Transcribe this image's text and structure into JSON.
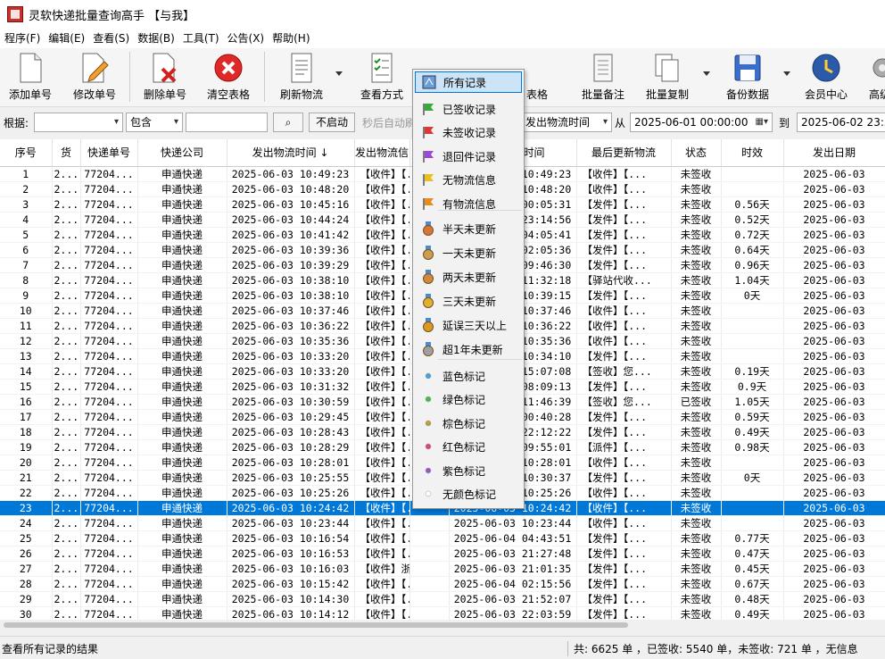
{
  "window": {
    "title": "灵软快递批量查询高手 【与我】"
  },
  "menu": [
    "程序(F)",
    "编辑(E)",
    "查看(S)",
    "数据(B)",
    "工具(T)",
    "公告(X)",
    "帮助(H)"
  ],
  "toolbar": {
    "add": "添加单号",
    "edit": "修改单号",
    "delete": "删除单号",
    "clear": "清空表格",
    "refresh": "刷新物流",
    "view_mode": "查看方式",
    "export": "表格",
    "batch_note": "批量备注",
    "batch_copy": "批量复制",
    "backup": "备份数据",
    "member": "会员中心",
    "advanced": "高级"
  },
  "filter": {
    "by_label": "根据:",
    "field_value": "",
    "match_value": "包含",
    "keyword_value": "",
    "not_started": "不启动",
    "auto_refresh_hint": "秒后自动刷",
    "time_field": "发出物流时间",
    "from_label": "从",
    "from_value": "2025-06-01 00:00:00",
    "to_label": "到",
    "to_value": "2025-06-02 23:5"
  },
  "columns": [
    "序号",
    "货",
    "快递单号",
    "快递公司",
    "发出物流时间 ↓",
    "发出物流信",
    "",
    "最后更新时间",
    "最后更新物流",
    "状态",
    "时效",
    "发出日期"
  ],
  "rows": [
    [
      "1",
      "2...",
      "77204...",
      "申通快递",
      "2025-06-03 10:49:23",
      "【收件】【...",
      "",
      "2025-06-03 10:49:23",
      "【收件】【...",
      "未签收",
      "",
      "2025-06-03"
    ],
    [
      "2",
      "2...",
      "77204...",
      "申通快递",
      "2025-06-03 10:48:20",
      "【收件】【...",
      "",
      "2025-06-03 10:48:20",
      "【收件】【...",
      "未签收",
      "",
      "2025-06-03"
    ],
    [
      "3",
      "2...",
      "77204...",
      "申通快递",
      "2025-06-03 10:45:16",
      "【收件】【...",
      "",
      "2025-06-04 00:05:31",
      "【发件】【...",
      "未签收",
      "0.56天",
      "2025-06-03"
    ],
    [
      "4",
      "2...",
      "77204...",
      "申通快递",
      "2025-06-03 10:44:24",
      "【收件】【...",
      "",
      "2025-06-03 23:14:56",
      "【发件】【...",
      "未签收",
      "0.52天",
      "2025-06-03"
    ],
    [
      "5",
      "2...",
      "77204...",
      "申通快递",
      "2025-06-03 10:41:42",
      "【收件】【...",
      "",
      "2025-06-04 04:05:41",
      "【发件】【...",
      "未签收",
      "0.72天",
      "2025-06-03"
    ],
    [
      "6",
      "2...",
      "77204...",
      "申通快递",
      "2025-06-03 10:39:36",
      "【收件】【...",
      "",
      "2025-06-04 02:05:36",
      "【发件】【...",
      "未签收",
      "0.64天",
      "2025-06-03"
    ],
    [
      "7",
      "2...",
      "77204...",
      "申通快递",
      "2025-06-03 10:39:29",
      "【收件】【...",
      "",
      "2025-06-04 09:46:30",
      "【发件】【...",
      "未签收",
      "0.96天",
      "2025-06-03"
    ],
    [
      "8",
      "2...",
      "77204...",
      "申通快递",
      "2025-06-03 10:38:10",
      "【收件】【...",
      "",
      "2025-06-04 11:32:18",
      "【驿站代收...",
      "未签收",
      "1.04天",
      "2025-06-03"
    ],
    [
      "9",
      "2...",
      "77204...",
      "申通快递",
      "2025-06-03 10:38:10",
      "【收件】【...",
      "",
      "2025-06-03 10:39:15",
      "【发件】【...",
      "未签收",
      "0天",
      "2025-06-03"
    ],
    [
      "10",
      "2...",
      "77204...",
      "申通快递",
      "2025-06-03 10:37:46",
      "【收件】【...",
      "",
      "2025-06-03 10:37:46",
      "【收件】【...",
      "未签收",
      "",
      "2025-06-03"
    ],
    [
      "11",
      "2...",
      "77204...",
      "申通快递",
      "2025-06-03 10:36:22",
      "【收件】【...",
      "",
      "2025-06-03 10:36:22",
      "【收件】【...",
      "未签收",
      "",
      "2025-06-03"
    ],
    [
      "12",
      "2...",
      "77204...",
      "申通快递",
      "2025-06-03 10:35:36",
      "【收件】【...",
      "",
      "2025-06-03 10:35:36",
      "【收件】【...",
      "未签收",
      "",
      "2025-06-03"
    ],
    [
      "13",
      "2...",
      "77204...",
      "申通快递",
      "2025-06-03 10:33:20",
      "【收件】【...",
      "",
      "2025-06-03 10:34:10",
      "【发件】【...",
      "未签收",
      "",
      "2025-06-03"
    ],
    [
      "14",
      "2...",
      "77204...",
      "申通快递",
      "2025-06-03 10:33:20",
      "【收件】【...",
      "",
      "2025-06-03 15:07:08",
      "【签收】您...",
      "未签收",
      "0.19天",
      "2025-06-03"
    ],
    [
      "15",
      "2...",
      "77204...",
      "申通快递",
      "2025-06-03 10:31:32",
      "【收件】【...",
      "",
      "2025-06-03 08:09:13",
      "【发件】【...",
      "未签收",
      "0.9天",
      "2025-06-03"
    ],
    [
      "16",
      "2...",
      "77204...",
      "申通快递",
      "2025-06-03 10:30:59",
      "【收件】【...",
      "",
      "2025-06-04 11:46:39",
      "【签收】您...",
      "已签收",
      "1.05天",
      "2025-06-03"
    ],
    [
      "17",
      "2...",
      "77204...",
      "申通快递",
      "2025-06-03 10:29:45",
      "【收件】【...",
      "",
      "2025-06-04 00:40:28",
      "【发件】【...",
      "未签收",
      "0.59天",
      "2025-06-03"
    ],
    [
      "18",
      "2...",
      "77204...",
      "申通快递",
      "2025-06-03 10:28:43",
      "【收件】【...",
      "",
      "2025-06-03 22:12:22",
      "【发件】【...",
      "未签收",
      "0.49天",
      "2025-06-03"
    ],
    [
      "19",
      "2...",
      "77204...",
      "申通快递",
      "2025-06-03 10:28:29",
      "【收件】【...",
      "",
      "2025-06-04 09:55:01",
      "【派件】【...",
      "未签收",
      "0.98天",
      "2025-06-03"
    ],
    [
      "20",
      "2...",
      "77204...",
      "申通快递",
      "2025-06-03 10:28:01",
      "【收件】【...",
      "",
      "2025-06-03 10:28:01",
      "【收件】【...",
      "未签收",
      "",
      "2025-06-03"
    ],
    [
      "21",
      "2...",
      "77204...",
      "申通快递",
      "2025-06-03 10:25:55",
      "【收件】【...",
      "",
      "2025-06-03 10:30:37",
      "【发件】【...",
      "未签收",
      "0天",
      "2025-06-03"
    ],
    [
      "22",
      "2...",
      "77204...",
      "申通快递",
      "2025-06-03 10:25:26",
      "【收件】【...",
      "",
      "2025-06-03 10:25:26",
      "【收件】【...",
      "未签收",
      "",
      "2025-06-03"
    ],
    [
      "23",
      "2...",
      "77204...",
      "申通快递",
      "2025-06-03 10:24:42",
      "【收件】【...",
      "",
      "2025-06-03 10:24:42",
      "【收件】【...",
      "未签收",
      "",
      "2025-06-03"
    ],
    [
      "24",
      "2...",
      "77204...",
      "申通快递",
      "2025-06-03 10:23:44",
      "【收件】【...",
      "",
      "2025-06-03 10:23:44",
      "【收件】【...",
      "未签收",
      "",
      "2025-06-03"
    ],
    [
      "25",
      "2...",
      "77204...",
      "申通快递",
      "2025-06-03 10:16:54",
      "【收件】【...",
      "",
      "2025-06-04 04:43:51",
      "【发件】【...",
      "未签收",
      "0.77天",
      "2025-06-03"
    ],
    [
      "26",
      "2...",
      "77204...",
      "申通快递",
      "2025-06-03 10:16:53",
      "【收件】【...",
      "",
      "2025-06-03 21:27:48",
      "【发件】【...",
      "未签收",
      "0.47天",
      "2025-06-03"
    ],
    [
      "27",
      "2...",
      "77204...",
      "申通快递",
      "2025-06-03 10:16:03",
      "【收件】浙...",
      "",
      "2025-06-03 21:01:35",
      "【发件】【...",
      "未签收",
      "0.45天",
      "2025-06-03"
    ],
    [
      "28",
      "2...",
      "77204...",
      "申通快递",
      "2025-06-03 10:15:42",
      "【收件】【...",
      "",
      "2025-06-04 02:15:56",
      "【发件】【...",
      "未签收",
      "0.67天",
      "2025-06-03"
    ],
    [
      "29",
      "2...",
      "77204...",
      "申通快递",
      "2025-06-03 10:14:30",
      "【收件】【...",
      "",
      "2025-06-03 21:52:07",
      "【发件】【...",
      "未签收",
      "0.48天",
      "2025-06-03"
    ],
    [
      "30",
      "2...",
      "77204...",
      "申通快递",
      "2025-06-03 10:14:12",
      "【收件】【...",
      "",
      "2025-06-03 22:03:59",
      "【发件】【...",
      "未签收",
      "0.49天",
      "2025-06-03"
    ]
  ],
  "selected_row": "23",
  "popup": [
    {
      "label": "所有记录",
      "icon": "all-records-icon",
      "color": "#6a9fd8"
    },
    {
      "label": "已签收记录",
      "icon": "green-flag-icon",
      "color": "#3aa83a"
    },
    {
      "label": "未签收记录",
      "icon": "red-flag-icon",
      "color": "#d83a3a"
    },
    {
      "label": "退回件记录",
      "icon": "purple-flag-icon",
      "color": "#9a4ad8"
    },
    {
      "label": "无物流信息",
      "icon": "yellow-flag-icon",
      "color": "#e8c020"
    },
    {
      "label": "有物流信息",
      "icon": "orange-flag-icon",
      "color": "#e88a20"
    },
    {
      "label": "半天未更新",
      "icon": "medal-icon",
      "color": "#d8763a"
    },
    {
      "label": "一天未更新",
      "icon": "medal-icon",
      "color": "#c8a050"
    },
    {
      "label": "两天未更新",
      "icon": "medal-icon",
      "color": "#d08a40"
    },
    {
      "label": "三天未更新",
      "icon": "medal-icon",
      "color": "#e0b030"
    },
    {
      "label": "延误三天以上",
      "icon": "medal-icon",
      "color": "#d89a20"
    },
    {
      "label": "超1年未更新",
      "icon": "medal-icon",
      "color": "#a0a0a0"
    },
    {
      "label": "蓝色标记",
      "icon": "dot-icon",
      "color": "#4aa0d8"
    },
    {
      "label": "绿色标记",
      "icon": "dot-icon",
      "color": "#48b848"
    },
    {
      "label": "棕色标记",
      "icon": "dot-icon",
      "color": "#b8a040"
    },
    {
      "label": "红色标记",
      "icon": "dot-icon",
      "color": "#d84868"
    },
    {
      "label": "紫色标记",
      "icon": "dot-icon",
      "color": "#9858c8"
    },
    {
      "label": "无颜色标记",
      "icon": "dot-icon",
      "color": "#ffffff"
    }
  ],
  "status": {
    "left": "查看所有记录的结果",
    "right": "共: 6625 单 ，已签收: 5540 单，未签收: 721 单 ，无信息"
  }
}
